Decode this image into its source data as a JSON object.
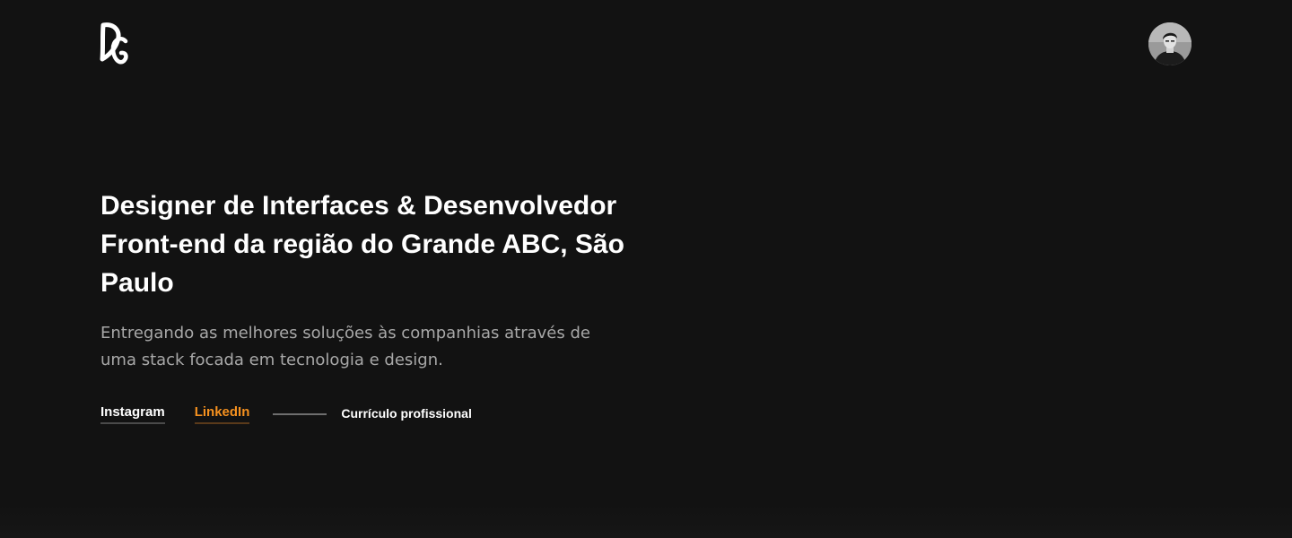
{
  "header": {
    "logo_alt": "DG",
    "avatar_alt": "profile photo"
  },
  "hero": {
    "title": "Designer de Interfaces & Desenvolvedor Front-end da região do Grande ABC, São Paulo",
    "subtitle": "Entregando as melhores soluções às companhias através de uma stack focada em tecnologia e design."
  },
  "links": {
    "instagram": "Instagram",
    "linkedin": "LinkedIn",
    "resume": "Currículo profissional"
  },
  "colors": {
    "background": "#121212",
    "accent": "#f5911f",
    "text": "#ffffff",
    "muted": "#a8a8a8"
  }
}
